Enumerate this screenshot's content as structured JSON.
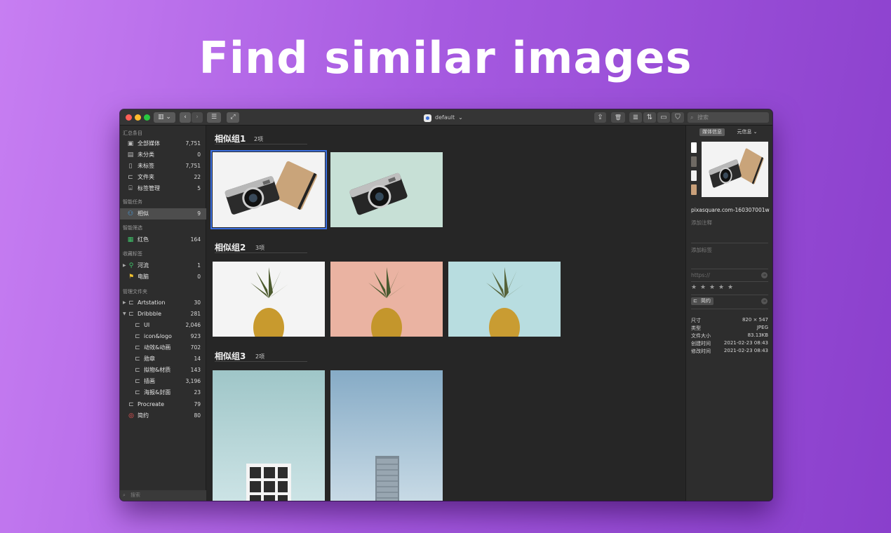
{
  "hero": {
    "title": "Find similar images"
  },
  "titlebar": {
    "library_name": "default",
    "library_chevron": "⌄",
    "search_placeholder": "搜索",
    "view_toggle": "▥ ⌄",
    "back_icon": "‹",
    "forward_icon": "›",
    "sort_menu": "☰",
    "fullscreen_icon": "⤢",
    "share_icon": "⇪",
    "trash_icon": "🗑",
    "list_icon": "≣",
    "sort_icon": "⇅",
    "preview_icon": "▭",
    "filter_icon": "⛉",
    "colors": {
      "close": "#ff5f57",
      "minimize": "#febc2e",
      "zoom": "#28c840"
    }
  },
  "sidebar": {
    "sections": {
      "summary": "汇总条目",
      "smart_tasks": "智能任务",
      "smart_filters": "智能筛选",
      "favorite_tags": "收藏标签",
      "manage_folders": "管理文件夹"
    },
    "summary_items": [
      {
        "label": "全部媒体",
        "count": "7,751",
        "icon": "media-icon"
      },
      {
        "label": "未分类",
        "count": "0",
        "icon": "uncategorized-icon"
      },
      {
        "label": "未标签",
        "count": "7,751",
        "icon": "untagged-icon"
      },
      {
        "label": "文件夹",
        "count": "22",
        "icon": "folder-icon"
      },
      {
        "label": "标签管理",
        "count": "5",
        "icon": "tag-icon"
      }
    ],
    "smart_task": {
      "label": "相似",
      "count": "9"
    },
    "smart_filter": {
      "label": "红色",
      "count": "164"
    },
    "tags": [
      {
        "label": "河流",
        "count": "1"
      },
      {
        "label": "电脑",
        "count": "0"
      }
    ],
    "folders": [
      {
        "label": "Artstation",
        "count": "30",
        "level": 0,
        "expander": "▶"
      },
      {
        "label": "Dribbble",
        "count": "281",
        "level": 0,
        "expander": "▼"
      },
      {
        "label": "UI",
        "count": "2,046",
        "level": 1
      },
      {
        "label": "icon&logo",
        "count": "923",
        "level": 1
      },
      {
        "label": "动效&动画",
        "count": "702",
        "level": 1
      },
      {
        "label": "勋章",
        "count": "14",
        "level": 1
      },
      {
        "label": "拟物&材质",
        "count": "143",
        "level": 1
      },
      {
        "label": "插画",
        "count": "3,196",
        "level": 1
      },
      {
        "label": "海报&封面",
        "count": "23",
        "level": 1
      },
      {
        "label": "Procreate",
        "count": "79",
        "level": 0
      },
      {
        "label": "简约",
        "count": "80",
        "level": 0
      }
    ],
    "search_placeholder": "搜索"
  },
  "main": {
    "groups": [
      {
        "title": "相似组1",
        "count": "2项"
      },
      {
        "title": "相似组2",
        "count": "3项"
      },
      {
        "title": "相似组3",
        "count": "2项"
      }
    ]
  },
  "inspector": {
    "tabs": {
      "media_info": "媒体信息",
      "meta_info": "元信息 ⌄"
    },
    "swatches": [
      "#ffffff",
      "#6f6a64",
      "#f2f2f2",
      "#c9a07a"
    ],
    "filename": "pixasquare.com-160307001w",
    "add_note": "添加注释",
    "add_tag": "添加标签",
    "url_placeholder": "https://",
    "rating": [
      "★",
      "★",
      "★",
      "★",
      "★"
    ],
    "folder_chip": "简约",
    "arrow_icon": "➜",
    "meta": [
      {
        "key": "尺寸",
        "value": "820 × 547"
      },
      {
        "key": "类型",
        "value": "JPEG"
      },
      {
        "key": "文件大小",
        "value": "83.13KB"
      },
      {
        "key": "创建时间",
        "value": "2021-02-23 08:43"
      },
      {
        "key": "修改时间",
        "value": "2021-02-23 08:43"
      }
    ]
  }
}
